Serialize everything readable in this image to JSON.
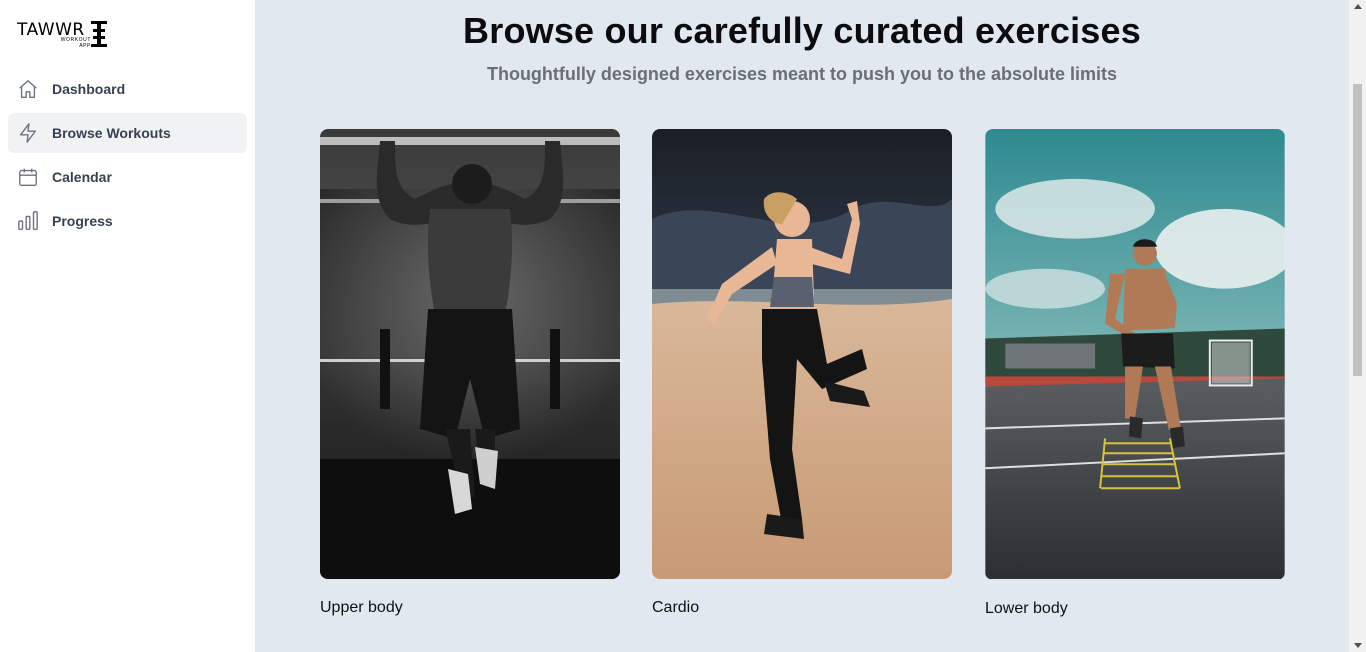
{
  "brand": {
    "name": "TAWWR",
    "tagline_1": "WORKOUT",
    "tagline_2": "APP"
  },
  "sidebar": {
    "items": [
      {
        "label": "Dashboard",
        "icon": "home-icon"
      },
      {
        "label": "Browse Workouts",
        "icon": "bolt-icon",
        "active": true
      },
      {
        "label": "Calendar",
        "icon": "calendar-icon"
      },
      {
        "label": "Progress",
        "icon": "chart-bar-icon"
      }
    ]
  },
  "main": {
    "title": "Browse our carefully curated exercises",
    "subtitle": "Thoughtfully designed exercises meant to push you to the absolute limits",
    "cards": [
      {
        "label": "Upper body"
      },
      {
        "label": "Cardio"
      },
      {
        "label": "Lower body"
      }
    ]
  },
  "colors": {
    "page_bg": "#e2e8f0",
    "sidebar_bg": "#ffffff",
    "active_item_bg": "#f1f2f4",
    "title": "#0b0b10",
    "subtitle": "#6b6e75"
  }
}
